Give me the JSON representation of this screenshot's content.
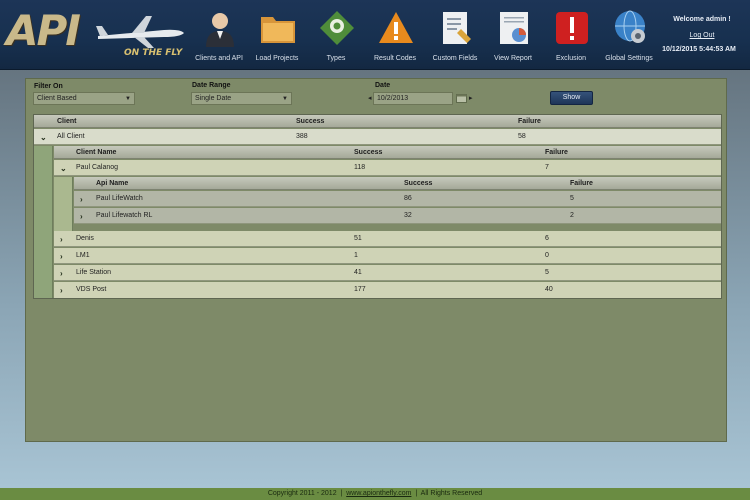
{
  "brand": {
    "logo_main": "API",
    "logo_sub": "ON THE FLY"
  },
  "nav": [
    {
      "label": "Clients and API",
      "icon": "user-icon"
    },
    {
      "label": "Load Projects",
      "icon": "folder-icon"
    },
    {
      "label": "Types",
      "icon": "tag-icon"
    },
    {
      "label": "Result Codes",
      "icon": "warning-icon"
    },
    {
      "label": "Custom Fields",
      "icon": "document-icon"
    },
    {
      "label": "View Report",
      "icon": "report-icon"
    },
    {
      "label": "Exclusion",
      "icon": "exclamation-icon"
    },
    {
      "label": "Global Settings",
      "icon": "globe-gear-icon"
    }
  ],
  "user": {
    "welcome": "Welcome admin !",
    "logout": "Log Out",
    "datetime": "10/12/2015 5:44:53 AM"
  },
  "filters": {
    "filter_on_label": "Filter On",
    "filter_on_value": "Client Based",
    "date_range_label": "Date Range",
    "date_range_value": "Single Date",
    "date_label": "Date",
    "date_value": "10/2/2013",
    "show_label": "Show"
  },
  "grid": {
    "headers": {
      "client": "Client",
      "success": "Success",
      "failure": "Failure"
    },
    "top_row": {
      "client": "All Client",
      "success": "388",
      "failure": "58"
    },
    "sub_headers": {
      "client_name": "Client Name",
      "success": "Success",
      "failure": "Failure"
    },
    "expanded_client": {
      "name": "Paul Calanog",
      "success": "118",
      "failure": "7"
    },
    "api_headers": {
      "api_name": "Api Name",
      "success": "Success",
      "failure": "Failure"
    },
    "api_rows": [
      {
        "name": "Paul LifeWatch",
        "success": "86",
        "failure": "5"
      },
      {
        "name": "Paul Lifewatch RL",
        "success": "32",
        "failure": "2"
      }
    ],
    "client_rows": [
      {
        "name": "Denis",
        "success": "51",
        "failure": "6"
      },
      {
        "name": "LM1",
        "success": "1",
        "failure": "0"
      },
      {
        "name": "Life Station",
        "success": "41",
        "failure": "5"
      },
      {
        "name": "VDS Post",
        "success": "177",
        "failure": "40"
      }
    ]
  },
  "footer": {
    "copyright": "Copyright 2011 - 2012",
    "sep1": "|",
    "link": "www.apionthefly.com",
    "sep2": "|",
    "rights": "All Rights Reserved"
  }
}
